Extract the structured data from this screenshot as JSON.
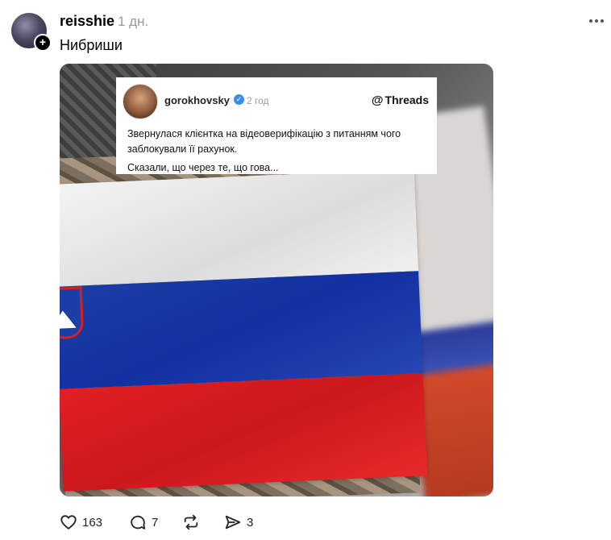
{
  "post": {
    "username": "reisshie",
    "timestamp": "1 дн.",
    "text": "Нибриши",
    "follow_icon_glyph": "+"
  },
  "embedded_threads": {
    "username": "gorokhovsky",
    "timestamp": "2 год",
    "brand": "Threads",
    "lines": [
      "Звернулася клієнтка на відеоверифікацію з питанням чого",
      "заблокували її рахунок.",
      "Сказали, що через те, що гова..."
    ]
  },
  "actions": {
    "likes": "163",
    "replies": "7",
    "reposts": "",
    "shares": "3"
  },
  "icons": {
    "more": "more-horizontal-icon",
    "like": "heart-icon",
    "reply": "comment-icon",
    "repost": "repost-icon",
    "share": "send-icon"
  },
  "colors": {
    "flag_white": "#f0f0f0",
    "flag_blue": "#1b3fa6",
    "flag_red": "#e02024",
    "verified": "#3a8ef0"
  }
}
